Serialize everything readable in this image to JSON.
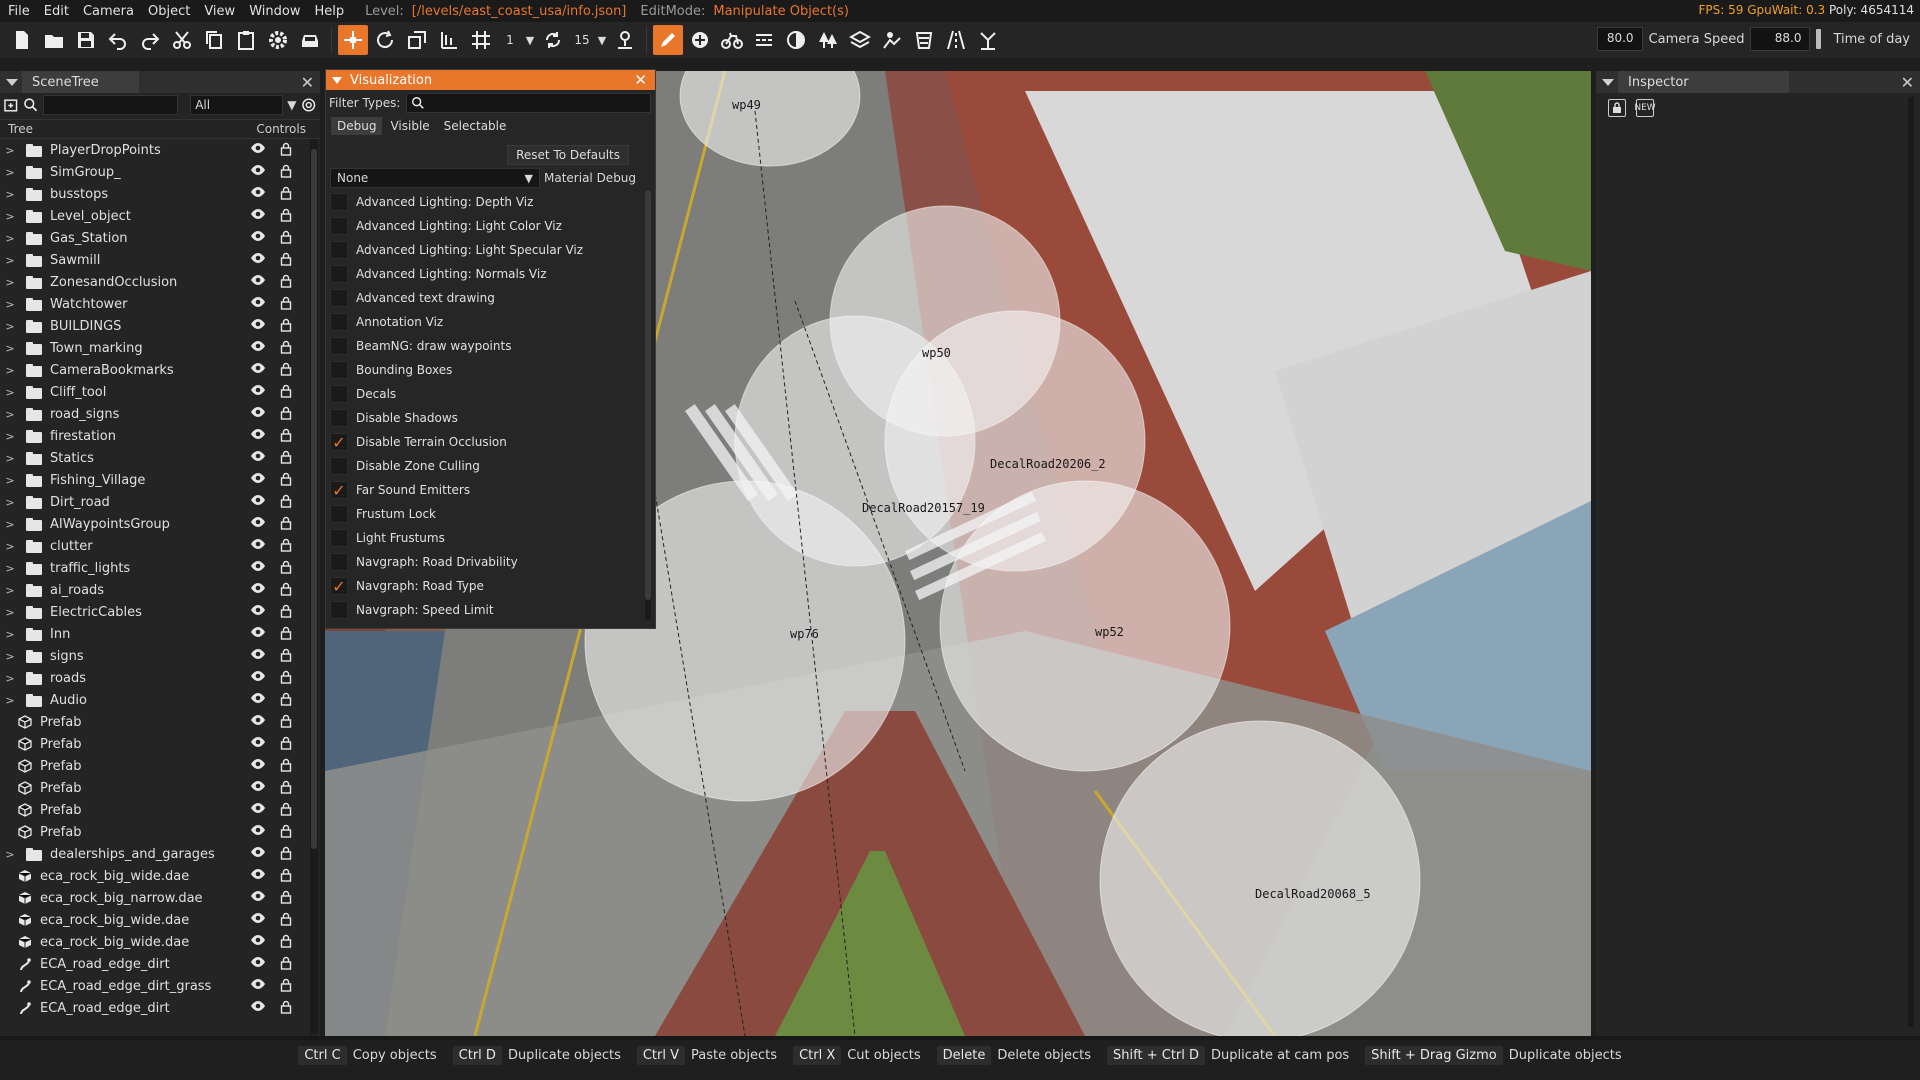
{
  "menu": {
    "items": [
      "File",
      "Edit",
      "Camera",
      "Object",
      "View",
      "Window",
      "Help"
    ],
    "level_label": "Level:",
    "level_value": "[/levels/east_coast_usa/info.json]",
    "editmode_label": "EditMode:",
    "editmode_value": "Manipulate Object(s)",
    "fps": "FPS: 59",
    "gpuwait": "GpuWait: 0.3",
    "poly": "Poly: 4654114"
  },
  "toolbar": {
    "snap_value": "1",
    "rotate_snap_value": "15",
    "fov_value": "80.0",
    "camera_speed_label": "Camera Speed",
    "camera_speed_value": "88.0",
    "time_of_day_label": "Time of day"
  },
  "scenetree": {
    "title": "SceneTree",
    "filter_value": "All",
    "col_tree": "Tree",
    "col_controls": "Controls",
    "items": [
      {
        "label": "PlayerDropPoints",
        "type": "folder"
      },
      {
        "label": "SimGroup_",
        "type": "folder"
      },
      {
        "label": "busstops",
        "type": "folder"
      },
      {
        "label": "Level_object",
        "type": "folder"
      },
      {
        "label": "Gas_Station",
        "type": "folder"
      },
      {
        "label": "Sawmill",
        "type": "folder"
      },
      {
        "label": "ZonesandOcclusion",
        "type": "folder"
      },
      {
        "label": "Watchtower",
        "type": "folder"
      },
      {
        "label": "BUILDINGS",
        "type": "folder"
      },
      {
        "label": "Town_marking",
        "type": "folder"
      },
      {
        "label": "CameraBookmarks",
        "type": "folder"
      },
      {
        "label": "Cliff_tool",
        "type": "folder"
      },
      {
        "label": "road_signs",
        "type": "folder"
      },
      {
        "label": "firestation",
        "type": "folder"
      },
      {
        "label": "Statics",
        "type": "folder"
      },
      {
        "label": "Fishing_Village",
        "type": "folder"
      },
      {
        "label": "Dirt_road",
        "type": "folder"
      },
      {
        "label": "AIWaypointsGroup",
        "type": "folder"
      },
      {
        "label": "clutter",
        "type": "folder"
      },
      {
        "label": "traffic_lights",
        "type": "folder"
      },
      {
        "label": "ai_roads",
        "type": "folder"
      },
      {
        "label": "ElectricCables",
        "type": "folder"
      },
      {
        "label": "Inn",
        "type": "folder"
      },
      {
        "label": "signs",
        "type": "folder"
      },
      {
        "label": "roads",
        "type": "folder"
      },
      {
        "label": "Audio",
        "type": "folder"
      },
      {
        "label": "Prefab",
        "type": "prefab"
      },
      {
        "label": "Prefab",
        "type": "prefab"
      },
      {
        "label": "Prefab",
        "type": "prefab"
      },
      {
        "label": "Prefab",
        "type": "prefab"
      },
      {
        "label": "Prefab",
        "type": "prefab"
      },
      {
        "label": "Prefab",
        "type": "prefab"
      },
      {
        "label": "dealerships_and_garages",
        "type": "folder"
      },
      {
        "label": "eca_rock_big_wide.dae",
        "type": "mesh"
      },
      {
        "label": "eca_rock_big_narrow.dae",
        "type": "mesh"
      },
      {
        "label": "eca_rock_big_wide.dae",
        "type": "mesh"
      },
      {
        "label": "eca_rock_big_wide.dae",
        "type": "mesh"
      },
      {
        "label": "ECA_road_edge_dirt",
        "type": "road"
      },
      {
        "label": "ECA_road_edge_dirt_grass",
        "type": "road"
      },
      {
        "label": "ECA_road_edge_dirt",
        "type": "road"
      }
    ]
  },
  "viz": {
    "title": "Visualization",
    "filter_label": "Filter Types:",
    "tabs": [
      "Debug",
      "Visible",
      "Selectable"
    ],
    "reset_label": "Reset To Defaults",
    "select_value": "None",
    "select_label": "Material Debug",
    "items": [
      {
        "label": "Advanced Lighting: Depth Viz",
        "checked": false
      },
      {
        "label": "Advanced Lighting: Light Color Viz",
        "checked": false
      },
      {
        "label": "Advanced Lighting: Light Specular Viz",
        "checked": false
      },
      {
        "label": "Advanced Lighting: Normals Viz",
        "checked": false
      },
      {
        "label": "Advanced text drawing",
        "checked": false
      },
      {
        "label": "Annotation Viz",
        "checked": false
      },
      {
        "label": "BeamNG: draw waypoints",
        "checked": false
      },
      {
        "label": "Bounding Boxes",
        "checked": false
      },
      {
        "label": "Decals",
        "checked": false
      },
      {
        "label": "Disable Shadows",
        "checked": false
      },
      {
        "label": "Disable Terrain Occlusion",
        "checked": true
      },
      {
        "label": "Disable Zone Culling",
        "checked": false
      },
      {
        "label": "Far Sound Emitters",
        "checked": true
      },
      {
        "label": "Frustum Lock",
        "checked": false
      },
      {
        "label": "Light Frustums",
        "checked": false
      },
      {
        "label": "Navgraph: Road Drivability",
        "checked": false
      },
      {
        "label": "Navgraph: Road Type",
        "checked": true
      },
      {
        "label": "Navgraph: Speed Limit",
        "checked": false
      }
    ]
  },
  "viewport": {
    "labels": [
      "wp49",
      "wp50",
      "DecalRoad20206_2",
      "DecalRoad20157_19",
      "wp76",
      "wp52",
      "DecalRoad20068_5"
    ]
  },
  "inspector": {
    "title": "Inspector",
    "new_icon_label": "NEW"
  },
  "shortcuts": [
    {
      "key": "Ctrl C",
      "desc": "Copy objects"
    },
    {
      "key": "Ctrl D",
      "desc": "Duplicate objects"
    },
    {
      "key": "Ctrl V",
      "desc": "Paste objects"
    },
    {
      "key": "Ctrl X",
      "desc": "Cut objects"
    },
    {
      "key": "Delete",
      "desc": "Delete objects"
    },
    {
      "key": "Shift + Ctrl D",
      "desc": "Duplicate at cam pos"
    },
    {
      "key": "Shift + Drag Gizmo",
      "desc": "Duplicate objects"
    }
  ],
  "colors": {
    "accent": "#e8762b",
    "panel_bg": "#242424",
    "checkmark": "#e8762b"
  }
}
